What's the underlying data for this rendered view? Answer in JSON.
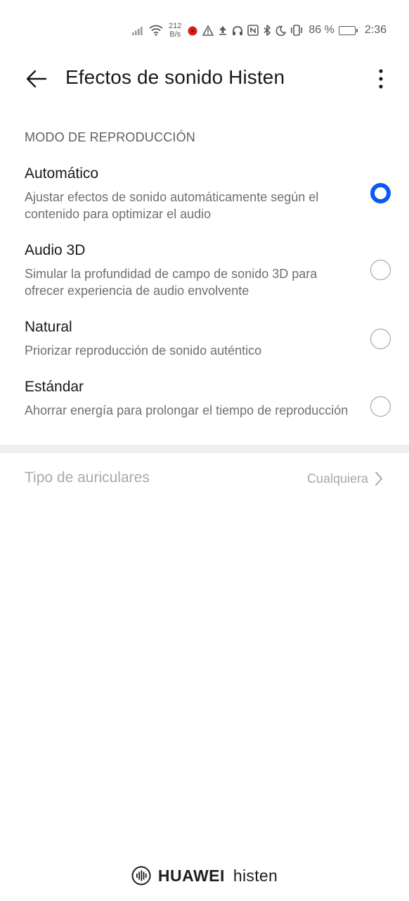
{
  "status_bar": {
    "net_speed_value": "212",
    "net_speed_unit": "B/s",
    "battery_percent": "86 %",
    "battery_level": 0.86,
    "time": "2:36",
    "icons": [
      "signal-icon",
      "wifi-icon",
      "app-notification-icon",
      "warning-icon",
      "upload-icon",
      "headphones-icon",
      "nfc-icon",
      "bluetooth-icon",
      "do-not-disturb-icon",
      "vibrate-icon",
      "battery-icon"
    ]
  },
  "header": {
    "title": "Efectos de sonido Histen",
    "back_icon": "arrow-left-icon",
    "more_icon": "more-vertical-icon"
  },
  "section": {
    "title": "MODO DE REPRODUCCIÓN"
  },
  "options": [
    {
      "title": "Automático",
      "desc": "Ajustar efectos de sonido automáticamente según el contenido para optimizar el audio",
      "selected": true
    },
    {
      "title": "Audio 3D",
      "desc": "Simular la profundidad de campo de sonido 3D para ofrecer experiencia de audio envolvente",
      "selected": false
    },
    {
      "title": "Natural",
      "desc": "Priorizar reproducción de sonido auténtico",
      "selected": false
    },
    {
      "title": "Estándar",
      "desc": "Ahorrar energía para prolongar el tiempo de reproducción",
      "selected": false
    }
  ],
  "earphone_type": {
    "label": "Tipo de auriculares",
    "value": "Cualquiera"
  },
  "footer": {
    "brand": "HUAWEI",
    "sub": "histen"
  },
  "colors": {
    "accent": "#0a59f7",
    "text_primary": "#191919",
    "text_secondary": "#6f6f6f",
    "disabled": "#a9a9a9"
  }
}
